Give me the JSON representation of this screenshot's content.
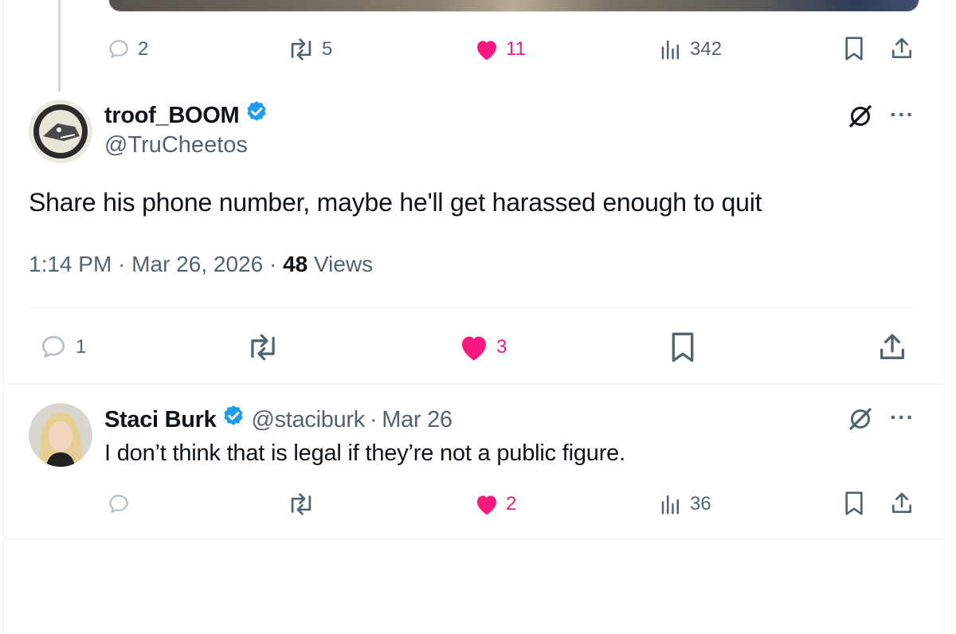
{
  "top_tweet": {
    "actions": {
      "replies": "2",
      "reposts": "5",
      "likes": "11",
      "views": "342"
    }
  },
  "main_tweet": {
    "display_name": "troof_BOOM",
    "handle": "@TruCheetos",
    "text": "Share his phone number, maybe he'll get harassed enough to quit",
    "time": "1:14 PM",
    "date": "Mar 26, 2026",
    "separator": "·",
    "views_count": "48",
    "views_label": "Views",
    "actions": {
      "replies": "1",
      "reposts": "",
      "likes": "3"
    }
  },
  "reply_tweet": {
    "display_name": "Staci Burk",
    "handle": "@staciburk",
    "separator": "·",
    "date": "Mar 26",
    "text": "I don’t think that is legal if they’re not a public figure.",
    "actions": {
      "replies": "",
      "reposts": "",
      "likes": "2",
      "views": "36"
    }
  },
  "more_label": "···",
  "colors": {
    "like_pink": "#f91880",
    "verified_blue": "#1d9bf0",
    "text_gray": "#536471",
    "divider": "#eff3f4"
  }
}
